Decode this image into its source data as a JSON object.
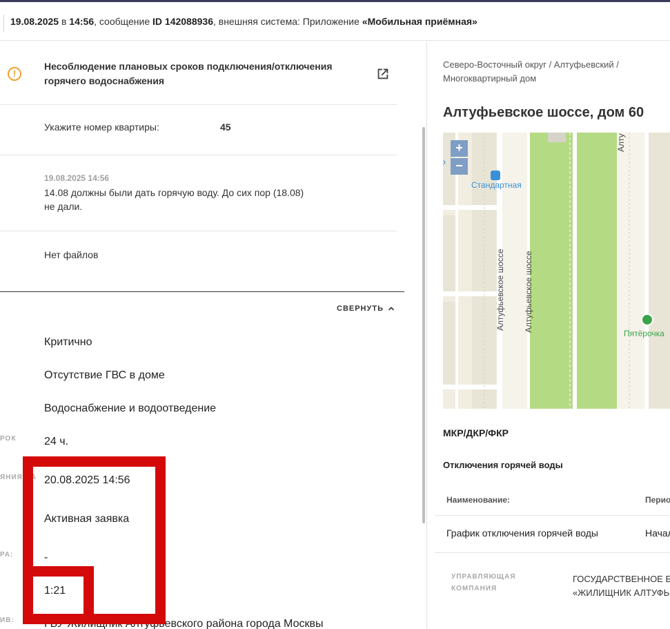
{
  "header": {
    "date_time": "19.08.2025",
    "at": "в",
    "time": "14:56",
    "message_prefix": ", сообщение",
    "message_id": "ID 142088936",
    "system_prefix": ", внешняя система: Приложение",
    "system_name": "«Мобильная приёмная»"
  },
  "issue": {
    "topic": "Несоблюдение плановых сроков подключения/отключения горячего водоснабжения",
    "apartment_label": "Укажите номер квартиры:",
    "apartment_value": "45",
    "message_date": "19.08.2025 14:56",
    "message_text": "14.08 должны были дать горячую воду. До сих пор (18.08) не дали.",
    "files": "Нет файлов"
  },
  "details": {
    "collapse_label": "СВЕРНУТЬ",
    "label_deadline": "РОК",
    "label_due": "ЯНИЯ НА",
    "label_executor": "РА:",
    "label_archive": "ИВ:",
    "priority": "Критично",
    "category": "Отсутствие ГВС в доме",
    "group": "Водоснабжение и водоотведение",
    "deadline": "24 ч.",
    "due_date": "20.08.2025 14:56",
    "status": "Активная заявка",
    "executor": "-",
    "time_left": "1:21",
    "organization": "ГБУ Жилищник Алтуфьевского района города Москвы"
  },
  "location": {
    "breadcrumb": "Северо-Восточный округ / Алтуфьевский / Многоквартирный дом",
    "address": "Алтуфьевское шоссе, дом 60",
    "map": {
      "zoom_in": "+",
      "zoom_out": "−",
      "stop_name": "Стандартная",
      "shop_name": "Пятёрочка",
      "road_name_1": "Алтуфьевское шоссе",
      "road_name_2": "Алтуфьевское шоссе",
      "road_name_3": "Алту",
      "edge_text": "Р"
    },
    "section_title": "МКР/ДКР/ФКР",
    "hot_water_title": "Отключения горячей воды",
    "table": {
      "col_name": "Наименование:",
      "col_period": "Период",
      "row_name": "График отключения горячей воды",
      "row_period": "Начал"
    },
    "mc_label": "УПРАВЛЯЮЩАЯ КОМПАНИЯ",
    "mc_value_line1": "ГОСУДАРСТВЕННОЕ Б",
    "mc_value_line2": "«ЖИЛИЩНИК АЛТУФЬ"
  },
  "colors": {
    "accent": "#3c3a5a",
    "warning": "#f0a030",
    "highlight": "#d40a0a",
    "map_green": "#b5da84"
  }
}
